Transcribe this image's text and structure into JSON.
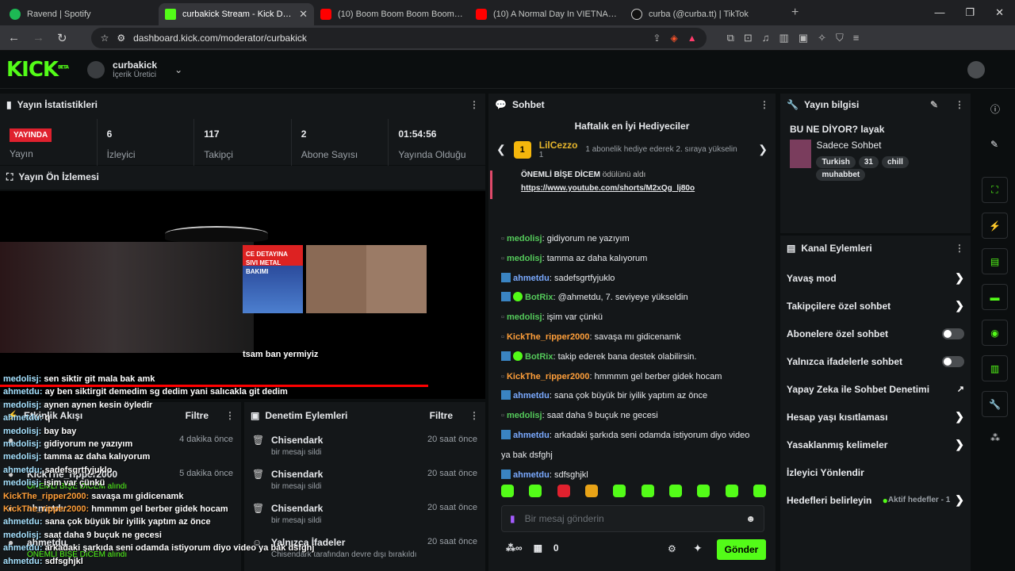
{
  "browser": {
    "tabs": [
      {
        "label": "Ravend | Spotify",
        "color": "#1db954"
      },
      {
        "label": "curbakick Stream - Kick Dashb",
        "color": "#53fc18"
      },
      {
        "label": "(10) Boom Boom Boom Boom - Ukra",
        "color": "#ff0000"
      },
      {
        "label": "(10) A Normal Day In VIETNAM - You",
        "color": "#ff0000"
      },
      {
        "label": "curba (@curba.tt) | TikTok",
        "color": "#ffffff"
      }
    ],
    "url": "dashboard.kick.com/moderator/curbakick"
  },
  "header": {
    "logo": "KICK",
    "logo_sup": "BETA",
    "channel_name": "curbakick",
    "channel_role": "İçerik Üretici"
  },
  "stats": {
    "title": "Yayın İstatistikleri",
    "live_label": "YAYINDA",
    "stream_label": "Yayın",
    "items": [
      {
        "value": "6",
        "label": "İzleyici"
      },
      {
        "value": "117",
        "label": "Takipçi"
      },
      {
        "value": "2",
        "label": "Abone Sayısı"
      },
      {
        "value": "01:54:56",
        "label": "Yayında Olduğu"
      }
    ]
  },
  "preview": {
    "title": "Yayın Ön İzlemesi",
    "thumb_text": "CE DETAYINA SIVI METAL BAKIMI",
    "video_text": "tsam ban yermiyiz",
    "overlay": [
      {
        "u": "medolisj:",
        "m": "sen siktir git mala bak amk"
      },
      {
        "u": "ahmetdu:",
        "m": "ay ben siktirgit demedim sg dedim yani salıcakla git dedim"
      },
      {
        "u": "medolisj:",
        "m": "aynen aynen kesin öyledir"
      },
      {
        "u": "ahmetdu:",
        "m": "q"
      },
      {
        "u": "medolisj:",
        "m": "bay bay"
      },
      {
        "u": "medolisj:",
        "m": "gidiyorum ne yazıyım"
      },
      {
        "u": "medolisj:",
        "m": "tamma az daha kalıyorum"
      },
      {
        "u": "ahmetdu:",
        "m": "sadefsgrtfyjuklo"
      },
      {
        "u": "medolisj:",
        "m": "işim var çünkü"
      },
      {
        "u": "KickThe_ripper2000:",
        "m": "savaşa mı gidicenamk"
      },
      {
        "u": "KickThe_ripper2000:",
        "m": "hmmmm gel berber gidek hocam"
      },
      {
        "u": "ahmetdu:",
        "m": "sana çok büyük bir iyilik yaptım az önce"
      },
      {
        "u": "medolisj:",
        "m": "saat daha 9 buçuk ne gecesi"
      },
      {
        "u": "ahmetdu:",
        "m": "arkadaki şarkıda seni odamda istiyorum diyo video ya bak dsfghj"
      },
      {
        "u": "ahmetdu:",
        "m": "sdfsghjkl"
      }
    ]
  },
  "activity": {
    "title": "Etkinlik Akışı",
    "filter": "Filtre",
    "rows": [
      {
        "who": "",
        "what": "",
        "when": "4 dakika önce"
      },
      {
        "who": "KickThe_ripper2000",
        "what": "ÖNEMLİ BİŞE DİCEM alındı",
        "when": "5 dakika önce"
      },
      {
        "who": "ahmetdu",
        "what": "",
        "when": ""
      },
      {
        "who": "ahmetdu",
        "what": "ÖNEMLİ BİŞE DİCEM alındı",
        "when": ""
      }
    ]
  },
  "moderation": {
    "title": "Denetim Eylemleri",
    "filter": "Filtre",
    "rows": [
      {
        "who": "Chisendark",
        "what": "bir mesajı sildi",
        "when": "20 saat önce"
      },
      {
        "who": "Chisendark",
        "what": "bir mesajı sildi",
        "when": "20 saat önce"
      },
      {
        "who": "Chisendark",
        "what": "bir mesajı sildi",
        "when": "20 saat önce"
      },
      {
        "who": "Yalnızca İfadeler",
        "what": "Chisendark tarafından devre dışı bırakıldı",
        "when": "20 saat önce"
      }
    ]
  },
  "chat": {
    "title": "Sohbet",
    "gifters_title": "Haftalık en İyi Hediyeciler",
    "top_user": "LilCezzo",
    "top_rank": "1",
    "top_count": "1",
    "top_note": "1 abonelik hediye ederek 2. sıraya yükselin",
    "reward_title": "ÖNEMLİ BİŞE DİCEM",
    "reward_suffix": "ödülünü aldı",
    "reward_link": "https://www.youtube.com/shorts/M2xQg_lj80o",
    "messages": [
      {
        "u": "medolisj",
        "c": "g",
        "m": ": gidiyorum ne yazıyım",
        "badge": ""
      },
      {
        "u": "medolisj",
        "c": "g",
        "m": ": tamma az daha kalıyorum",
        "badge": ""
      },
      {
        "u": "ahmetdu",
        "c": "b",
        "m": ": sadefsgrtfyjuklo",
        "badge": "b"
      },
      {
        "u": "BotRix",
        "c": "g",
        "m": ": @ahmetdu, 7. seviyeye yükseldin",
        "badge": "bv"
      },
      {
        "u": "medolisj",
        "c": "g",
        "m": ": işim var çünkü",
        "badge": ""
      },
      {
        "u": "KickThe_ripper2000",
        "c": "o",
        "m": ": savaşa mı gidicenamk",
        "badge": ""
      },
      {
        "u": "BotRix",
        "c": "g",
        "m": ": takip ederek bana destek olabilirsin.",
        "badge": "bv"
      },
      {
        "u": "KickThe_ripper2000",
        "c": "o",
        "m": ": hmmmm gel berber gidek hocam",
        "badge": ""
      },
      {
        "u": "ahmetdu",
        "c": "b",
        "m": ": sana çok büyük bir iyilik yaptım az önce",
        "badge": "b"
      },
      {
        "u": "medolisj",
        "c": "g",
        "m": ": saat daha 9 buçuk ne gecesi",
        "badge": ""
      },
      {
        "u": "ahmetdu",
        "c": "b",
        "m": ": arkadaki şarkıda seni odamda istiyorum diyo video",
        "badge": "b"
      },
      {
        "u": "",
        "c": "",
        "m": "ya bak dsfghj",
        "badge": ""
      },
      {
        "u": "ahmetdu",
        "c": "b",
        "m": ": sdfsghjkl",
        "badge": "b"
      }
    ],
    "placeholder": "Bir mesaj gönderin",
    "viewer_count": "0",
    "send": "Gönder"
  },
  "stream_info": {
    "title": "Yayın bilgisi",
    "stream_title": "BU NE DİYOR? layak",
    "category": "Sadece Sohbet",
    "tags": [
      "Turkish",
      "31",
      "chill",
      "muhabbet"
    ]
  },
  "channel_actions": {
    "title": "Kanal Eylemleri",
    "items": [
      {
        "label": "Yavaş mod",
        "type": "arrow"
      },
      {
        "label": "Takipçilere özel sohbet",
        "type": "arrow"
      },
      {
        "label": "Abonelere özel sohbet",
        "type": "toggle"
      },
      {
        "label": "Yalnızca ifadelerle sohbet",
        "type": "toggle"
      },
      {
        "label": "Yapay Zeka ile Sohbet Denetimi",
        "type": "ext"
      },
      {
        "label": "Hesap yaşı kısıtlaması",
        "type": "arrow"
      },
      {
        "label": "Yasaklanmış kelimeler",
        "type": "arrow"
      },
      {
        "label": "İzleyici Yönlendir",
        "type": "none"
      },
      {
        "label": "Hedefleri belirleyin",
        "type": "goal"
      }
    ],
    "goal_status": "Aktif hedefler - 1"
  },
  "colors": {
    "brand": "#53fc18",
    "live": "#e0212e",
    "bg": "#0b0e0f",
    "panel": "#141719"
  }
}
